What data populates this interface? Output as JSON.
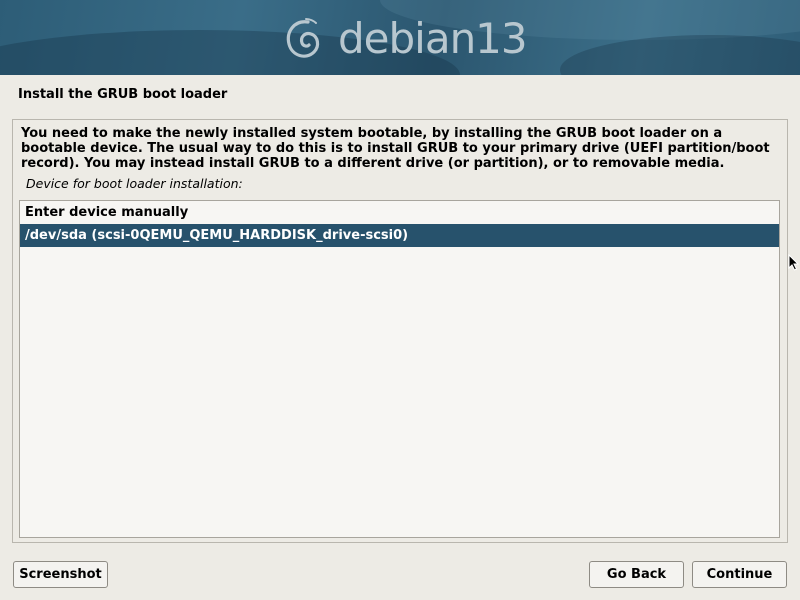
{
  "banner": {
    "logo_text": "debian13",
    "logo_icon": "debian-swirl-icon"
  },
  "page": {
    "title": "Install the GRUB boot loader",
    "description": "You need to make the newly installed system bootable, by installing the GRUB boot loader on a bootable device. The usual way to do this is to install GRUB to your primary drive (UEFI partition/boot record). You may instead install GRUB to a different drive (or partition), or to removable media.",
    "field_label": "Device for boot loader installation:"
  },
  "device_list": {
    "items": [
      {
        "label": "Enter device manually",
        "selected": false
      },
      {
        "label": "/dev/sda  (scsi-0QEMU_QEMU_HARDDISK_drive-scsi0)",
        "selected": true
      }
    ]
  },
  "buttons": {
    "screenshot": "Screenshot",
    "go_back": "Go Back",
    "continue": "Continue"
  },
  "colors": {
    "banner": "#2d5d77",
    "selection": "#27526c",
    "background": "#edebe5"
  }
}
